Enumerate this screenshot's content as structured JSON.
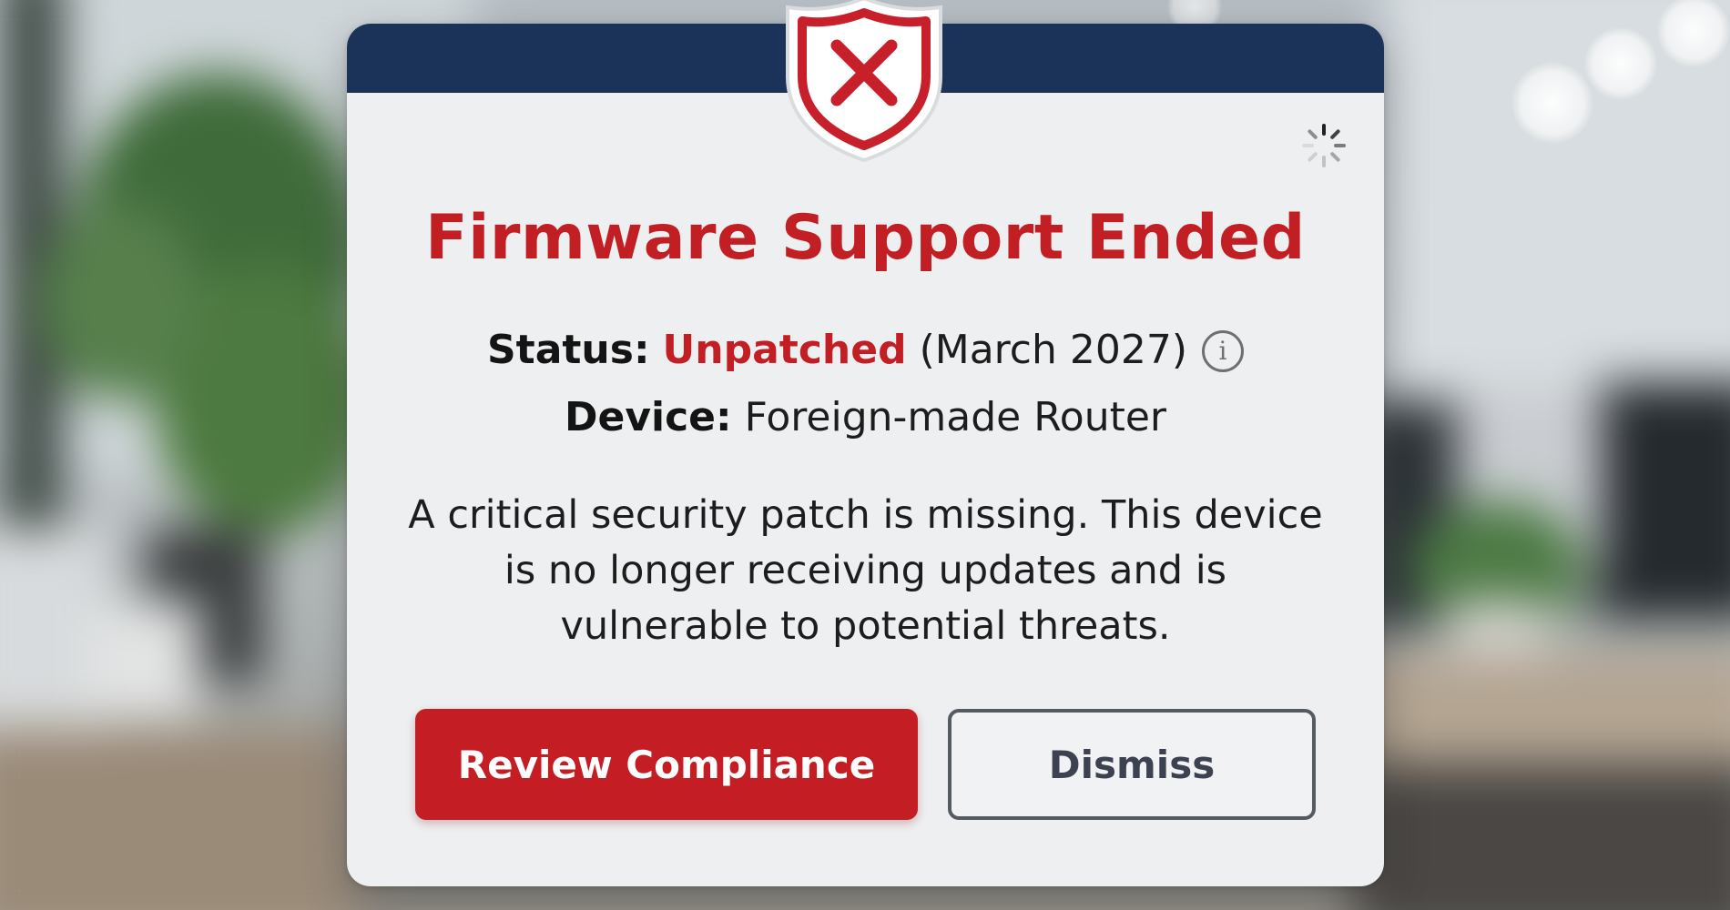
{
  "dialog": {
    "title": "Firmware Support Ended",
    "status": {
      "label": "Status:",
      "value": "Unpatched",
      "date": "(March 2027)"
    },
    "device": {
      "label": "Device:",
      "value": "Foreign-made Router"
    },
    "message": "A critical security patch is missing. This device is no longer receiving updates and is vulnerable to potential threats.",
    "buttons": {
      "primary_label": "Review Compliance",
      "secondary_label": "Dismiss"
    },
    "icons": {
      "header": "shield-x-icon",
      "info": "info-icon",
      "loading": "spinner-icon"
    }
  },
  "colors": {
    "header_bar": "#1b3358",
    "alert_red": "#c21f24",
    "dialog_bg": "#eeeff1",
    "dismiss_border": "#555a63"
  }
}
